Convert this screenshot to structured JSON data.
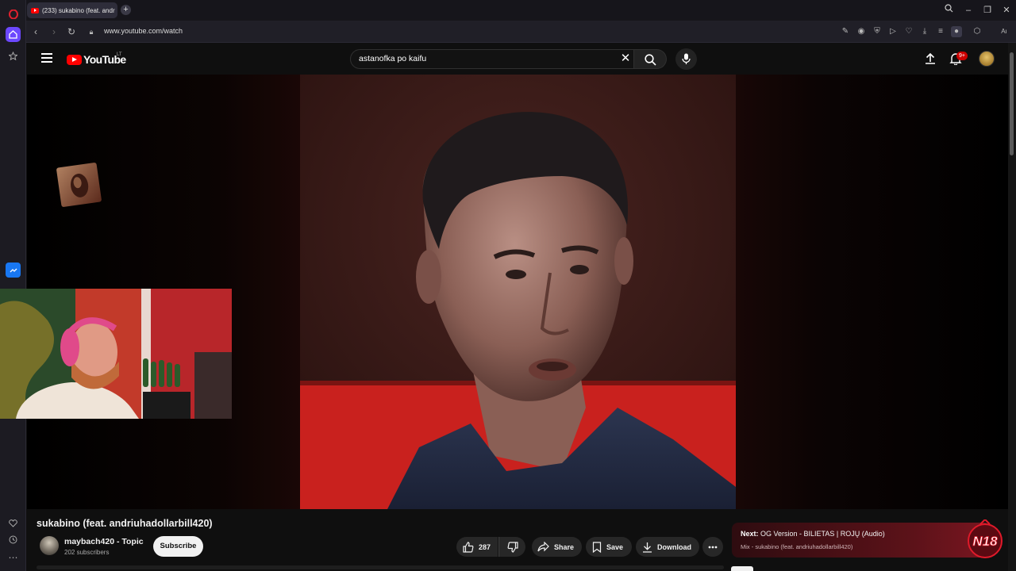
{
  "browser": {
    "tab_title": "(233) sukabino (feat. andr",
    "url": "www.youtube.com/watch"
  },
  "youtube": {
    "logo_text": "YouTube",
    "country_code": "LT",
    "search_value": "astanofka po kaifu",
    "notification_count": "9+"
  },
  "video": {
    "title": "sukabino (feat. andriuhadollarbill420)",
    "channel_name": "maybach420 - Topic",
    "subscribers": "202 subscribers",
    "subscribe_label": "Subscribe",
    "likes": "287",
    "share_label": "Share",
    "save_label": "Save",
    "download_label": "Download"
  },
  "next": {
    "prefix": "Next:",
    "title": "OG Version - BILIETAS | ROJŲ (Audio)",
    "subtitle": "Mix - sukabino (feat. andriuhadollarbill420)"
  },
  "overlay": {
    "logo_text": "N18"
  },
  "colors": {
    "accent_red": "#ff0000",
    "background": "#0f0f0f",
    "pill": "#272727"
  }
}
